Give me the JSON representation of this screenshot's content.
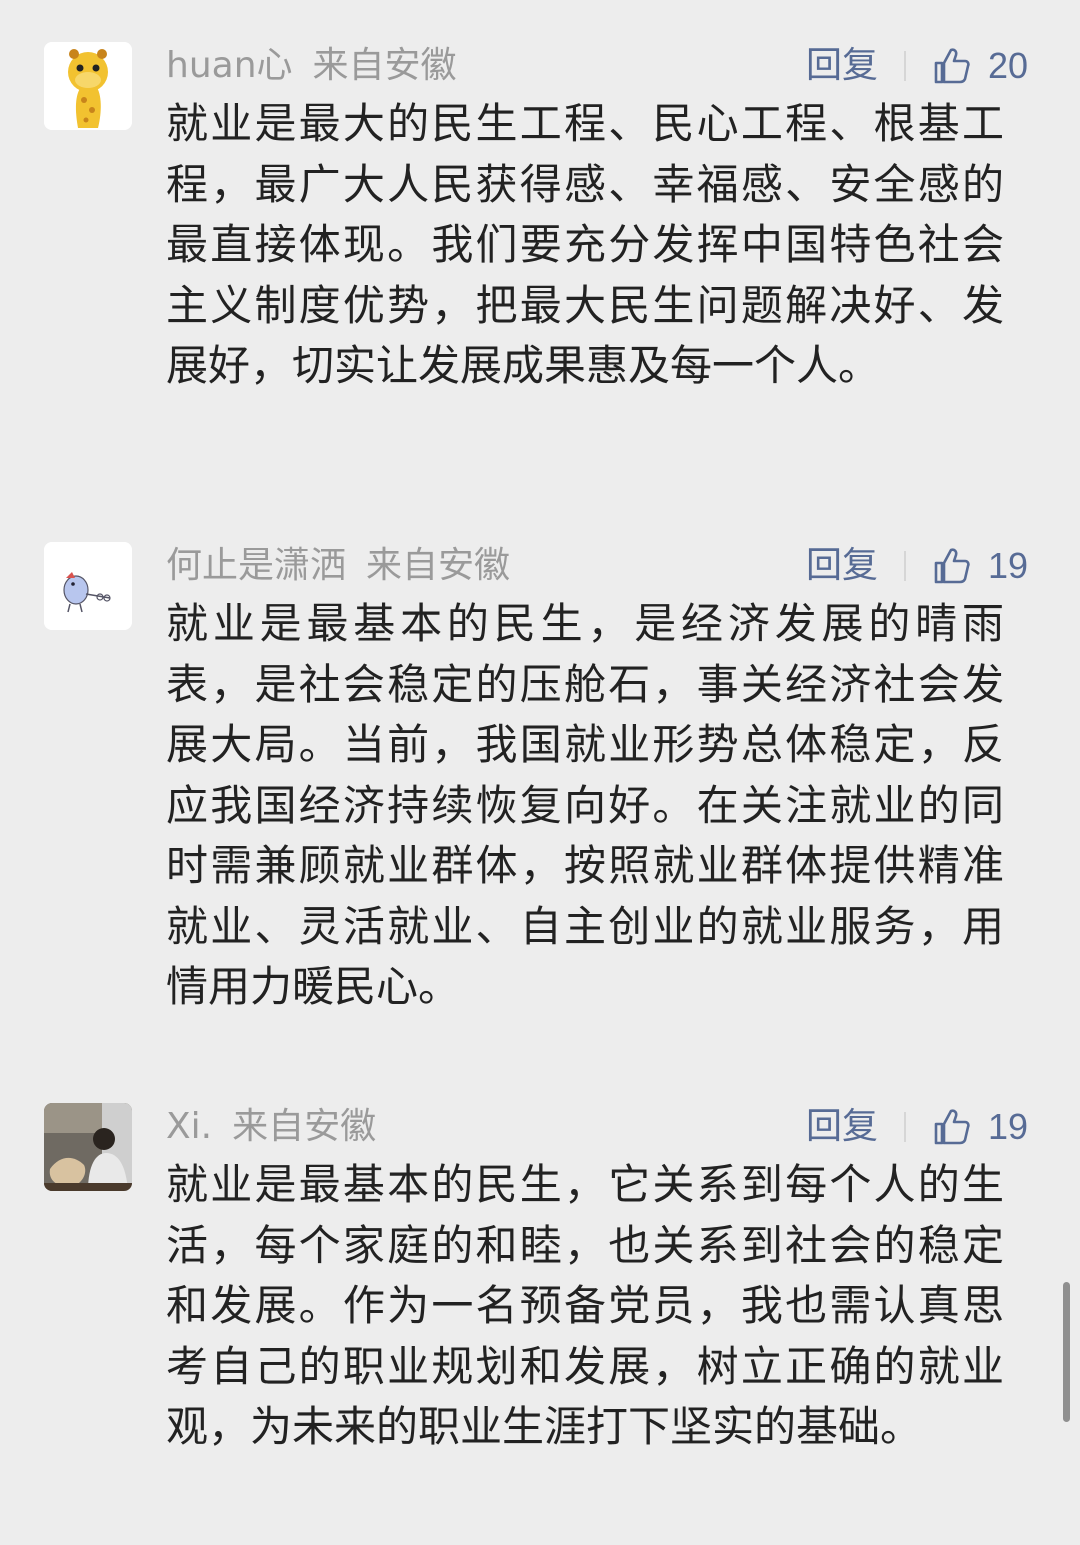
{
  "comments": [
    {
      "author": "huan心",
      "region": "来自安徽",
      "reply_label": "回复",
      "likes": "20",
      "avatar_icon": "giraffe-icon",
      "text": "就业是最大的民生工程、民心工程、根基工程，最广大人民获得感、幸福感、安全感的最直接体现。我们要充分发挥中国特色社会主义制度优势，把最大民生问题解决好、发展好，切实让发展成果惠及每一个人。"
    },
    {
      "author": "何止是潇洒",
      "region": "来自安徽",
      "reply_label": "回复",
      "likes": "19",
      "avatar_icon": "cartoon-bird-icon",
      "text": "就业是最基本的民生，是经济发展的晴雨表，是社会稳定的压舱石，事关经济社会发展大局。当前，我国就业形势总体稳定，反应我国经济持续恢复向好。在关注就业的同时需兼顾就业群体，按照就业群体提供精准就业、灵活就业、自主创业的就业服务，用情用力暖民心。"
    },
    {
      "author": "Xi.",
      "region": "来自安徽",
      "reply_label": "回复",
      "likes": "19",
      "avatar_icon": "person-photo-icon",
      "text": "就业是最基本的民生，它关系到每个人的生活，每个家庭的和睦，也关系到社会的稳定和发展。作为一名预备党员，我也需认真思考自己的职业规划和发展，树立正确的就业观，为未来的职业生涯打下坚实的基础。"
    }
  ],
  "colors": {
    "background": "#ededed",
    "link": "#576b95",
    "meta": "#9a9a9a",
    "text": "#222222"
  }
}
